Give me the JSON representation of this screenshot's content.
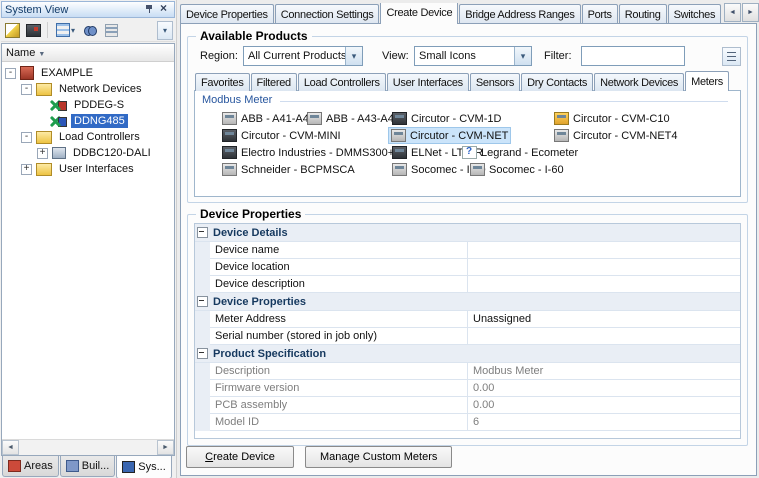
{
  "left_panel": {
    "title": "System View",
    "columns": {
      "name": "Name"
    },
    "tree": {
      "items": [
        {
          "label": "EXAMPLE"
        },
        {
          "label": "Network Devices"
        },
        {
          "label": "PDDEG-S"
        },
        {
          "label": "DDNG485"
        },
        {
          "label": "Load Controllers"
        },
        {
          "label": "DDBC120-DALI"
        },
        {
          "label": "User Interfaces"
        }
      ],
      "selected": "DDNG485"
    },
    "bottom_tabs": [
      {
        "label": "Areas"
      },
      {
        "label": "Buil..."
      },
      {
        "label": "Sys..."
      }
    ],
    "active_bottom_tab": "Sys..."
  },
  "main_tabs": [
    {
      "label": "Device Properties"
    },
    {
      "label": "Connection Settings"
    },
    {
      "label": "Create Device"
    },
    {
      "label": "Bridge Address Ranges"
    },
    {
      "label": "Ports"
    },
    {
      "label": "Routing"
    },
    {
      "label": "Switches"
    }
  ],
  "active_main_tab": "Create Device",
  "available_products": {
    "heading": "Available Products",
    "region_label": "Region:",
    "region_value": "All Current Products",
    "view_label": "View:",
    "view_value": "Small Icons",
    "filter_label": "Filter:",
    "filter_value": "",
    "category_tabs": [
      {
        "label": "Favorites"
      },
      {
        "label": "Filtered"
      },
      {
        "label": "Load Controllers"
      },
      {
        "label": "User Interfaces"
      },
      {
        "label": "Sensors"
      },
      {
        "label": "Dry Contacts"
      },
      {
        "label": "Network Devices"
      },
      {
        "label": "Meters"
      }
    ],
    "active_category_tab": "Meters",
    "group_label": "Modbus Meter",
    "items": [
      {
        "label": "ABB - A41-A42"
      },
      {
        "label": "ABB - A43-A44"
      },
      {
        "label": "Circutor - CVM-1D"
      },
      {
        "label": "Circutor - CVM-C10"
      },
      {
        "label": "Circutor - CVM-MINI"
      },
      {
        "label": "Circutor - CVM-NET"
      },
      {
        "label": "Circutor - CVM-NET4"
      },
      {
        "label": "Electro Industries - DMMS300+"
      },
      {
        "label": "ELNet - LT/GR"
      },
      {
        "label": "Legrand - Ecometer"
      },
      {
        "label": "Schneider - BCPMSCA"
      },
      {
        "label": "Socomec - I-30"
      },
      {
        "label": "Socomec - I-60"
      }
    ],
    "selected_item": "Circutor - CVM-NET"
  },
  "device_properties": {
    "heading": "Device Properties",
    "rows": [
      {
        "type": "category",
        "name": "Device Details"
      },
      {
        "type": "property",
        "name": "Device name",
        "value": ""
      },
      {
        "type": "property",
        "name": "Device location",
        "value": ""
      },
      {
        "type": "property",
        "name": "Device description",
        "value": ""
      },
      {
        "type": "category",
        "name": "Device Properties"
      },
      {
        "type": "property",
        "name": "Meter Address",
        "value": "Unassigned"
      },
      {
        "type": "property",
        "name": "Serial number (stored in job only)",
        "value": ""
      },
      {
        "type": "category",
        "name": "Product Specification"
      },
      {
        "type": "property",
        "name": "Description",
        "value": "Modbus Meter",
        "readonly": true
      },
      {
        "type": "property",
        "name": "Firmware version",
        "value": "0.00",
        "readonly": true
      },
      {
        "type": "property",
        "name": "PCB assembly",
        "value": "0.00",
        "readonly": true
      },
      {
        "type": "property",
        "name": "Model ID",
        "value": "6",
        "readonly": true
      }
    ]
  },
  "actions": {
    "create_device": "Create Device",
    "manage_custom_meters": "Manage Custom Meters"
  }
}
